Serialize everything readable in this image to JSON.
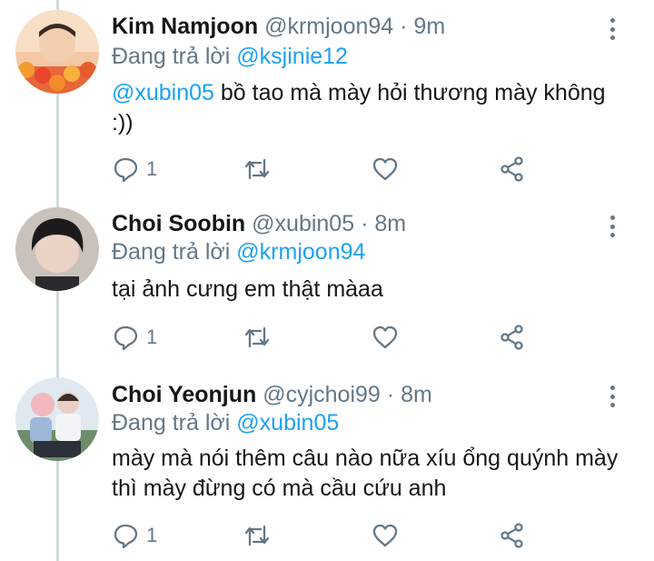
{
  "tweets": [
    {
      "name": "Kim Namjoon",
      "handle": "@krmjoon94",
      "separator": "·",
      "time": "9m",
      "replying_prefix": "Đang trả lời",
      "replying_to": "@ksjinie12",
      "body_mention": "@xubin05",
      "body_text": " bồ tao mà mày hỏi thương mày không :))",
      "reply_count": "1"
    },
    {
      "name": "Choi Soobin",
      "handle": "@xubin05",
      "separator": "·",
      "time": "8m",
      "replying_prefix": "Đang trả lời",
      "replying_to": "@krmjoon94",
      "body_mention": "",
      "body_text": "tại ảnh cưng em thật màaa",
      "reply_count": "1"
    },
    {
      "name": "Choi Yeonjun",
      "handle": "@cyjchoi99",
      "separator": "·",
      "time": "8m",
      "replying_prefix": "Đang trả lời",
      "replying_to": "@xubin05",
      "body_mention": "",
      "body_text": "mày mà nói thêm câu nào nữa xíu ổng quýnh mày thì mày đừng có mà cầu cứu anh",
      "reply_count": "1"
    }
  ],
  "icons": {
    "reply": "reply-icon",
    "retweet": "retweet-icon",
    "like": "like-icon",
    "share": "share-icon",
    "more": "more-vertical-icon"
  },
  "colors": {
    "accent": "#1da1f2",
    "muted": "#657786",
    "text": "#14171a",
    "thread_line": "#cfd9de"
  }
}
